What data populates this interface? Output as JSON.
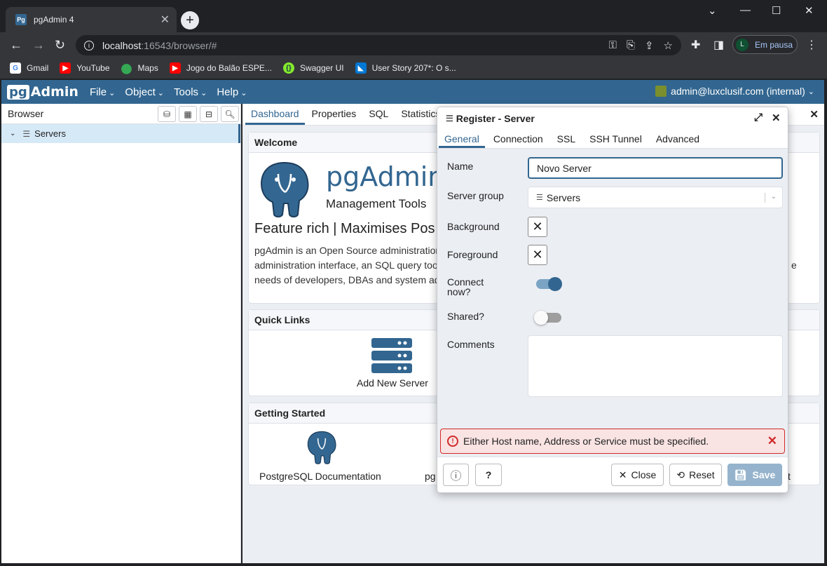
{
  "browser_chrome": {
    "tab_title": "pgAdmin 4",
    "tab_favicon_text": "Pg",
    "url_host": "localhost",
    "url_rest": ":16543/browser/#",
    "profile_initial": "L",
    "profile_status": "Em pausa",
    "bookmarks": [
      {
        "label": "Gmail",
        "icon": "google-icon",
        "color": "#4285f4"
      },
      {
        "label": "YouTube",
        "icon": "youtube-icon",
        "color": "#ff0000"
      },
      {
        "label": "Maps",
        "icon": "maps-icon",
        "color": "#34a853"
      },
      {
        "label": "Jogo do Balão ESPE...",
        "icon": "youtube-icon",
        "color": "#ff0000"
      },
      {
        "label": "Swagger UI",
        "icon": "swagger-icon",
        "color": "#85ea2d"
      },
      {
        "label": "User Story 207*: O s...",
        "icon": "azure-devops-icon",
        "color": "#0078d4"
      }
    ]
  },
  "app": {
    "logo_pg": "pg",
    "logo_rest": "Admin",
    "menus": [
      "File",
      "Object",
      "Tools",
      "Help"
    ],
    "user": "admin@luxclusif.com (internal)"
  },
  "browser_panel": {
    "title": "Browser",
    "tree": [
      {
        "label": "Servers",
        "expanded": true
      }
    ]
  },
  "main": {
    "tabs": [
      "Dashboard",
      "Properties",
      "SQL",
      "Statistics"
    ],
    "active_tab": "Dashboard",
    "welcome": {
      "heading": "Welcome",
      "brand": "pgAdmin",
      "subtitle": "Management Tools",
      "feature": "Feature rich | Maximises Pos",
      "desc_line1": "pgAdmin is an Open Source administration",
      "desc_line2": "administration interface, an SQL query too",
      "desc_line2_tail": "e",
      "desc_line3": "needs of developers, DBAs and system ad"
    },
    "quick_links": {
      "heading": "Quick Links",
      "add_server": "Add New Server"
    },
    "getting_started": {
      "heading": "Getting Started",
      "pg_docs": "PostgreSQL Documentation",
      "partial_left": "pg",
      "partial_right": "t"
    }
  },
  "dialog": {
    "title": "Register - Server",
    "tabs": [
      "General",
      "Connection",
      "SSL",
      "SSH Tunnel",
      "Advanced"
    ],
    "active_tab": "General",
    "fields": {
      "name_label": "Name",
      "name_value": "Novo Server",
      "group_label": "Server group",
      "group_value": "Servers",
      "bg_label": "Background",
      "fg_label": "Foreground",
      "connect_label_1": "Connect",
      "connect_label_2": "now?",
      "connect_value": true,
      "shared_label": "Shared?",
      "shared_value": false,
      "comments_label": "Comments",
      "comments_value": ""
    },
    "error": "Either Host name, Address or Service must be specified.",
    "buttons": {
      "close": "Close",
      "reset": "Reset",
      "save": "Save"
    }
  },
  "colors": {
    "brand": "#326690",
    "error": "#d12a2a",
    "save_disabled": "#95b3cc"
  }
}
